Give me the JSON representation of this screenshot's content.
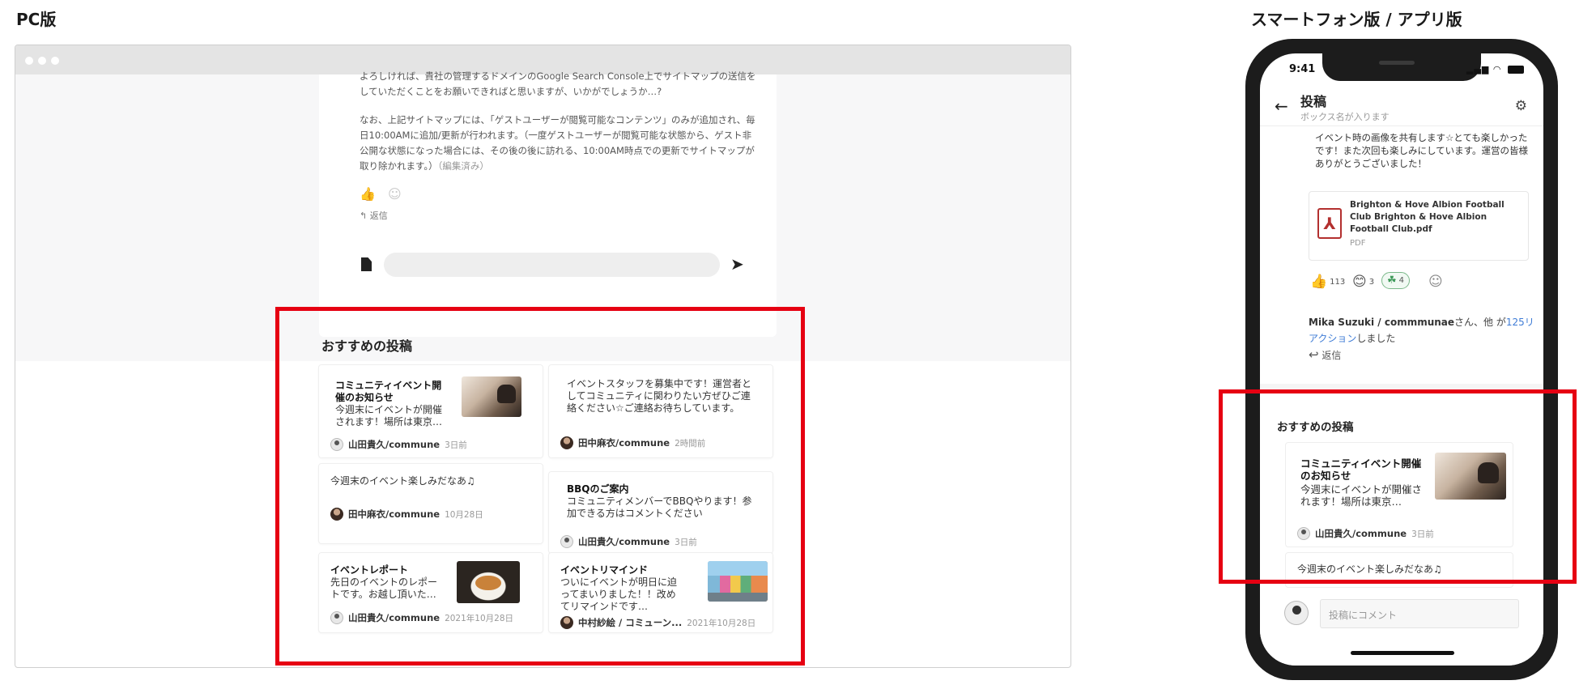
{
  "labels": {
    "pc": "PC版",
    "sp": "スマートフォン版 / アプリ版"
  },
  "pc": {
    "post": {
      "text_partial": "よろしければ、貴社の管理するドメインのGoogle Search Console上でサイトマップの送信をしていただくことをお願いできればと思いますが、いかがでしょうか…?",
      "text_main": "なお、上記サイトマップには、「ゲストユーザーが閲覧可能なコンテンツ」のみが追加され、毎日10:00AMに追加/更新が行われます。（一度ゲストユーザーが閲覧可能な状態から、ゲスト非公開な状態になった場合には、その後の後に訪れる、10:00AM時点での更新でサイトマップが取り除かれます。）",
      "edited": "（編集済み）",
      "reply_label": "返信"
    },
    "recommend_title": "おすすめの投稿",
    "cards": [
      {
        "title": "コミュニティイベント開催のお知らせ",
        "body": "今週末にイベントが開催されます！場所は東京…",
        "author": "山田貴久/commune",
        "time": "3日前"
      },
      {
        "title": "",
        "body": "イベントスタッフを募集中です！運営者としてコミュニティに関わりたい方ぜひご連絡ください☆ご連絡お待ちしています。",
        "author": "田中麻衣/commune",
        "time": "2時間前"
      },
      {
        "title": "",
        "body": "今週末のイベント楽しみだなあ♫",
        "author": "田中麻衣/commune",
        "time": "10月28日"
      },
      {
        "title": "BBQのご案内",
        "body": "コミュニティメンバーでBBQやります！参加できる方はコメントください",
        "author": "山田貴久/commune",
        "time": "3日前"
      },
      {
        "title": "イベントレポート",
        "body": "先日のイベントのレポートです。お越し頂いた…",
        "author": "山田貴久/commune",
        "time": "2021年10月28日"
      },
      {
        "title": "イベントリマインド",
        "body": "ついにイベントが明日に迫ってまいりました！！改めてリマインドです…",
        "author": "中村紗絵 / コミューン...",
        "time": "2021年10月28日"
      }
    ]
  },
  "mobile": {
    "status_time": "9:41",
    "header_title": "投稿",
    "header_sub": "ボックス名が入ります",
    "post_text": "イベント時の画像を共有します☆とても楽しかったです！また次回も楽しみにしています。運営の皆様ありがとうございました！",
    "file_name": "Brighton & Hove Albion Football Club Brighton & Hove Albion Football Club.pdf",
    "file_type": "PDF",
    "reactions": [
      {
        "icon": "thumbs-up-icon",
        "count": "113"
      },
      {
        "icon": "smile-icon",
        "count": "3"
      },
      {
        "icon": "custom-stamp-icon",
        "count": "4"
      }
    ],
    "reacted_who": "Mika Suzuki / commmunae",
    "reacted_mid": "さん、他 が",
    "reacted_link": "125リアクション",
    "reacted_end": "しました",
    "reply_label": "返信",
    "recommend_title": "おすすめの投稿",
    "card": {
      "title": "コミュニティイベント開催のお知らせ",
      "body": "今週末にイベントが開催されます！場所は東京…",
      "author": "山田貴久/commune",
      "time": "3日前"
    },
    "card2_body": "今週末のイベント楽しみだなあ♫",
    "comment_placeholder": "投稿にコメント"
  },
  "colors": {
    "highlight": "#e60012",
    "link": "#3f7cd6",
    "pdf": "#b3302f"
  }
}
